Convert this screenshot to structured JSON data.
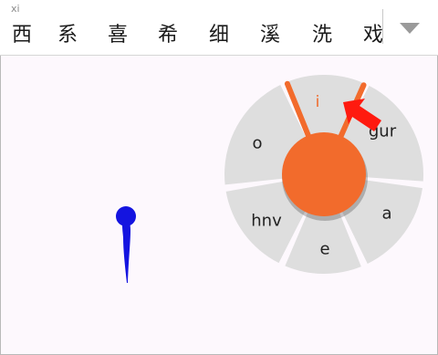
{
  "candidate_bar": {
    "pinyin": "xi",
    "candidates": [
      "西",
      "系",
      "喜",
      "希",
      "细",
      "溪",
      "洗",
      "戏"
    ],
    "expand_icon": "triangle-down-icon"
  },
  "wheel": {
    "segments": [
      {
        "id": "i",
        "label": "i",
        "active": true
      },
      {
        "id": "gur",
        "label": "gur"
      },
      {
        "id": "a",
        "label": "a"
      },
      {
        "id": "e",
        "label": "e"
      },
      {
        "id": "hnv",
        "label": "hnv"
      },
      {
        "id": "o",
        "label": "o"
      }
    ],
    "colors": {
      "segment": "#dedede",
      "center": "#f26b2c",
      "highlight": "#f26b2c",
      "pointer": "#ff1a0f"
    }
  },
  "stylus_color": "#1414e0",
  "background": "#fdf8fd"
}
